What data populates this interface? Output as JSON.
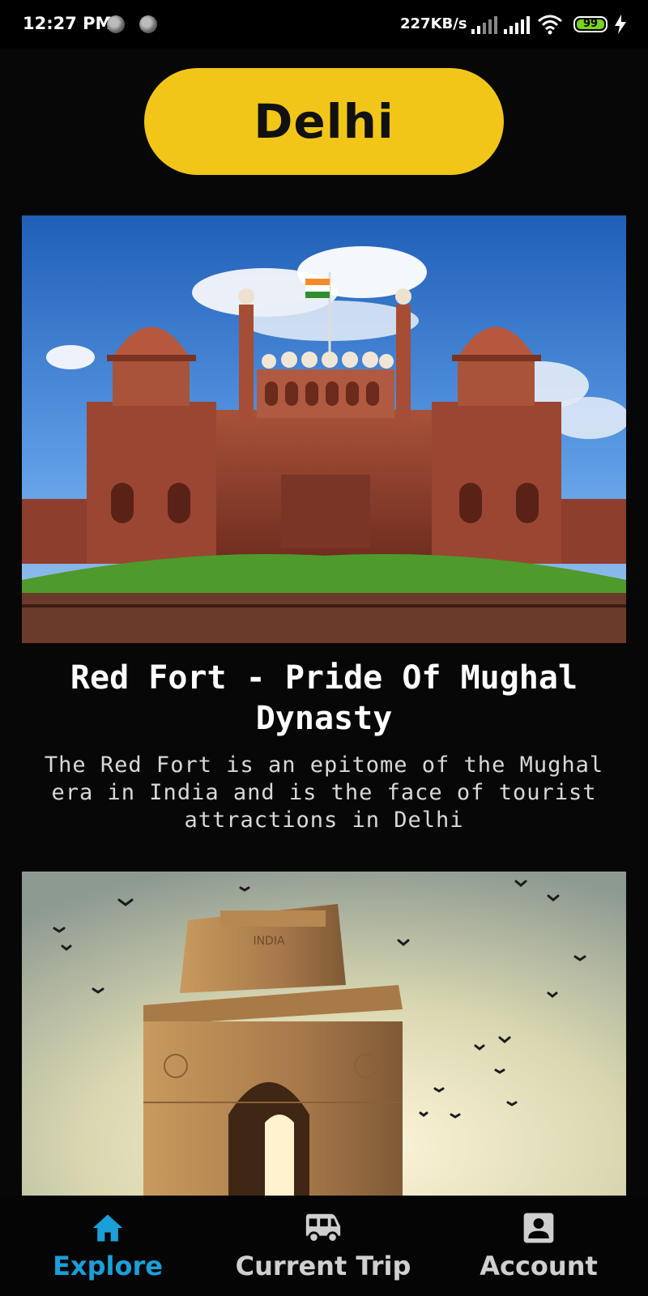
{
  "status_bar": {
    "time": "12:27 PM",
    "net_speed": "227KB/s",
    "battery": "99"
  },
  "header": {
    "city": "Delhi"
  },
  "places": [
    {
      "title": "Red Fort - Pride Of Mughal Dynasty",
      "description": "The Red Fort is an epitome of the Mughal era in India and is the face of tourist attractions in Delhi"
    },
    {
      "image_caption": "INDIA"
    }
  ],
  "nav": {
    "items": [
      {
        "label": "Explore",
        "icon": "home-icon"
      },
      {
        "label": "Current Trip",
        "icon": "bus-icon"
      },
      {
        "label": "Account",
        "icon": "account-icon"
      }
    ],
    "active_color": "#1a9fd8",
    "inactive_color": "#cfcfcf"
  },
  "colors": {
    "accent": "#f2c618",
    "background": "#070707"
  }
}
